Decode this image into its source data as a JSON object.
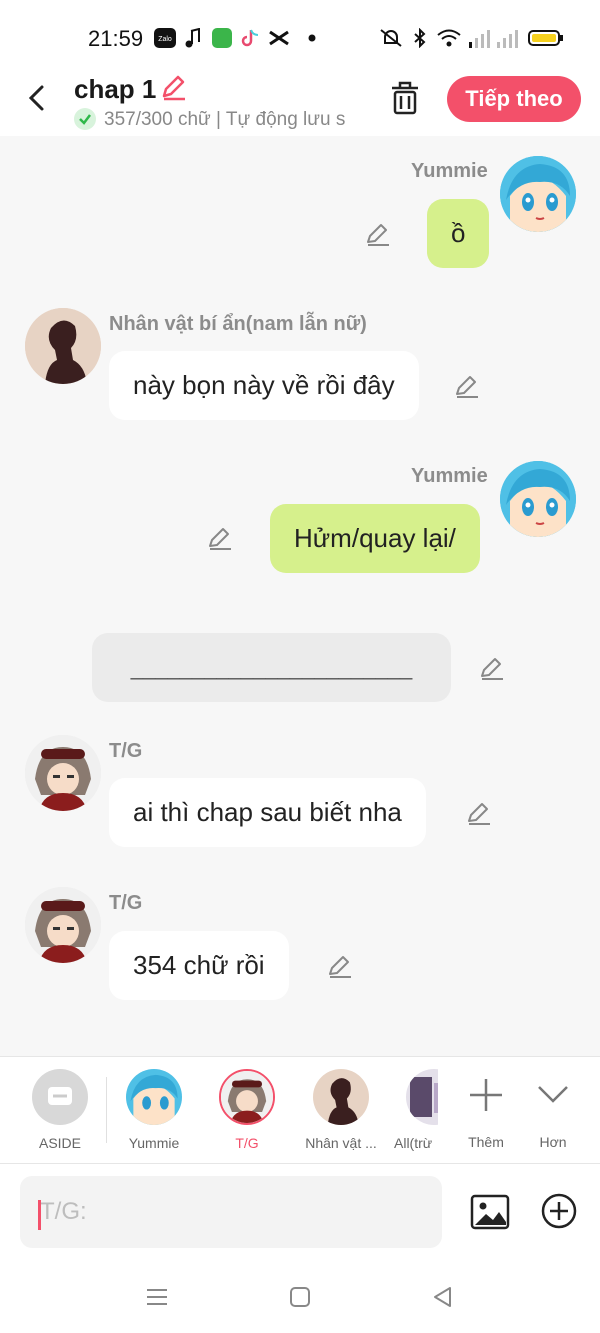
{
  "status_bar": {
    "time": "21:59",
    "icons": [
      "zalo-icon",
      "music-icon",
      "app-icon",
      "tiktok-icon",
      "capcut-icon",
      "dot-icon",
      "mute-icon",
      "bluetooth-icon",
      "wifi-icon",
      "signal-icon",
      "signal-icon",
      "battery-icon"
    ]
  },
  "header": {
    "title": "chap 1",
    "subtitle": "357/300 chữ | Tự động lưu s",
    "next_label": "Tiếp theo",
    "accent": "#f3506a"
  },
  "messages": [
    {
      "side": "right",
      "name": "Yummie",
      "text": "ồ"
    },
    {
      "side": "left",
      "name": "Nhân vật bí ẩn(nam lẫn nữ)",
      "text": "này bọn này về rồi đây"
    },
    {
      "side": "right",
      "name": "Yummie",
      "text": "Hửm/quay lại/"
    },
    {
      "side": "aside",
      "text": "_______________________"
    },
    {
      "side": "left",
      "name": "T/G",
      "text": "ai thì chap sau biết nha"
    },
    {
      "side": "left",
      "name": "T/G",
      "text": "354 chữ rồi"
    }
  ],
  "characters": [
    {
      "label": "ASIDE"
    },
    {
      "label": "Yummie"
    },
    {
      "label": "T/G",
      "active": true
    },
    {
      "label": "Nhân vật ..."
    },
    {
      "label": "All(trừ"
    },
    {
      "label": "Thêm"
    },
    {
      "label": "Hơn"
    }
  ],
  "input": {
    "placeholder": "T/G:"
  }
}
